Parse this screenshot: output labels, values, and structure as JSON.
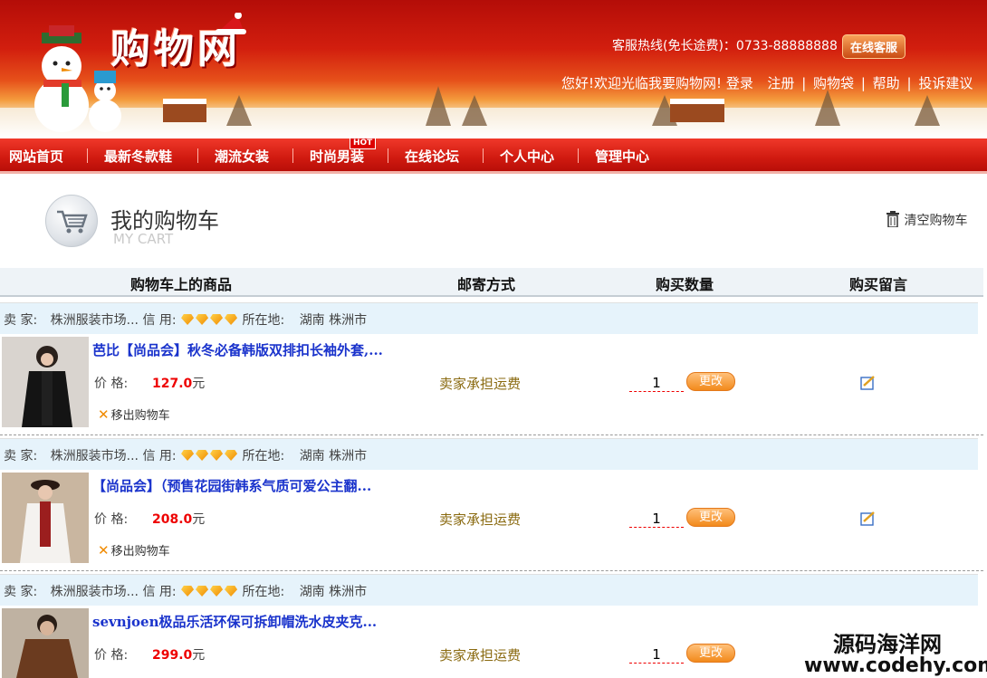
{
  "banner": {
    "logo": "购物网",
    "hotline": "客服热线(免长途费)：0733-88888888",
    "online_service": "在线客服",
    "welcome": "您好!欢迎光临我要购物网!",
    "links": [
      "登录",
      "注册",
      "购物袋",
      "帮助",
      "投诉建议"
    ]
  },
  "nav": {
    "items": [
      "网站首页",
      "最新冬款鞋",
      "潮流女装",
      "时尚男装",
      "在线论坛",
      "个人中心",
      "管理中心"
    ],
    "hot_badge": "HOT"
  },
  "cart": {
    "title": "我的购物车",
    "subtitle": "MY CART",
    "clear": "清空购物车"
  },
  "table": {
    "headers": [
      "购物车上的商品",
      "邮寄方式",
      "购买数量",
      "购买留言"
    ]
  },
  "labels": {
    "seller": "卖 家:",
    "credit": "信 用:",
    "location": "所在地:",
    "price": "价 格:",
    "currency": "元",
    "remove": "移出购物车",
    "update": "更改"
  },
  "items": [
    {
      "seller": "株洲服装市场...",
      "credit_level": 4,
      "location": "湖南 株洲市",
      "name": "芭比【尚品会】秋冬必备韩版双排扣长袖外套,...",
      "price": "127.0",
      "shipping": "卖家承担运费",
      "quantity": "1"
    },
    {
      "seller": "株洲服装市场...",
      "credit_level": 4,
      "location": "湖南 株洲市",
      "name": "【尚品会】（预售花园街韩系气质可爱公主翻...",
      "price": "208.0",
      "shipping": "卖家承担运费",
      "quantity": "1"
    },
    {
      "seller": "株洲服装市场...",
      "credit_level": 4,
      "location": "湖南 株洲市",
      "name": "sevnjoen极品乐活环保可拆卸帽洗水皮夹克...",
      "price": "299.0",
      "shipping": "卖家承担运费",
      "quantity": "1"
    }
  ],
  "watermark": {
    "line1": "源码海洋网",
    "line2": "www.codehy.com"
  },
  "colors": {
    "nav_red": "#d01a10",
    "link_blue": "#1a33cc",
    "price_red": "#ee0000",
    "seller_bar": "#e6f3fb",
    "button_orange": "#f28a1c"
  }
}
